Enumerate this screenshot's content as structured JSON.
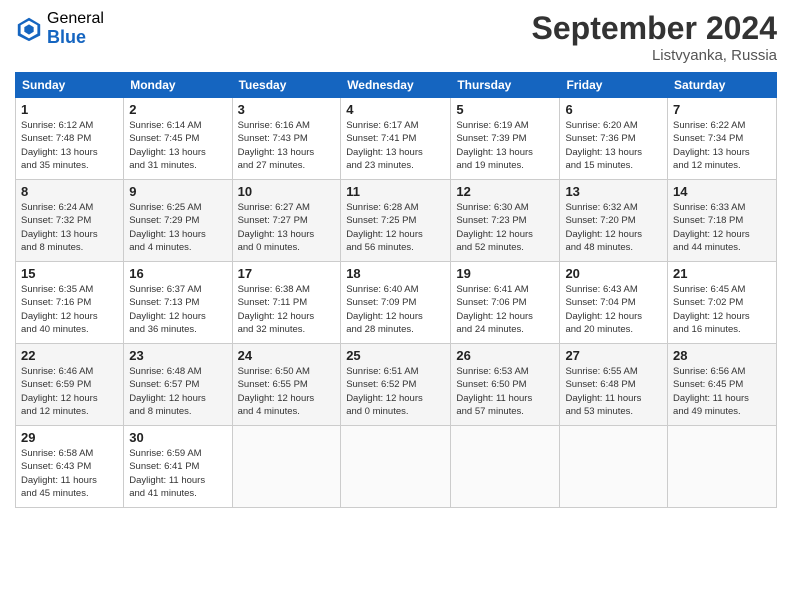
{
  "header": {
    "logo_general": "General",
    "logo_blue": "Blue",
    "month_title": "September 2024",
    "subtitle": "Listvyanka, Russia"
  },
  "weekdays": [
    "Sunday",
    "Monday",
    "Tuesday",
    "Wednesday",
    "Thursday",
    "Friday",
    "Saturday"
  ],
  "weeks": [
    [
      {
        "day": "1",
        "info": "Sunrise: 6:12 AM\nSunset: 7:48 PM\nDaylight: 13 hours\nand 35 minutes."
      },
      {
        "day": "2",
        "info": "Sunrise: 6:14 AM\nSunset: 7:45 PM\nDaylight: 13 hours\nand 31 minutes."
      },
      {
        "day": "3",
        "info": "Sunrise: 6:16 AM\nSunset: 7:43 PM\nDaylight: 13 hours\nand 27 minutes."
      },
      {
        "day": "4",
        "info": "Sunrise: 6:17 AM\nSunset: 7:41 PM\nDaylight: 13 hours\nand 23 minutes."
      },
      {
        "day": "5",
        "info": "Sunrise: 6:19 AM\nSunset: 7:39 PM\nDaylight: 13 hours\nand 19 minutes."
      },
      {
        "day": "6",
        "info": "Sunrise: 6:20 AM\nSunset: 7:36 PM\nDaylight: 13 hours\nand 15 minutes."
      },
      {
        "day": "7",
        "info": "Sunrise: 6:22 AM\nSunset: 7:34 PM\nDaylight: 13 hours\nand 12 minutes."
      }
    ],
    [
      {
        "day": "8",
        "info": "Sunrise: 6:24 AM\nSunset: 7:32 PM\nDaylight: 13 hours\nand 8 minutes."
      },
      {
        "day": "9",
        "info": "Sunrise: 6:25 AM\nSunset: 7:29 PM\nDaylight: 13 hours\nand 4 minutes."
      },
      {
        "day": "10",
        "info": "Sunrise: 6:27 AM\nSunset: 7:27 PM\nDaylight: 13 hours\nand 0 minutes."
      },
      {
        "day": "11",
        "info": "Sunrise: 6:28 AM\nSunset: 7:25 PM\nDaylight: 12 hours\nand 56 minutes."
      },
      {
        "day": "12",
        "info": "Sunrise: 6:30 AM\nSunset: 7:23 PM\nDaylight: 12 hours\nand 52 minutes."
      },
      {
        "day": "13",
        "info": "Sunrise: 6:32 AM\nSunset: 7:20 PM\nDaylight: 12 hours\nand 48 minutes."
      },
      {
        "day": "14",
        "info": "Sunrise: 6:33 AM\nSunset: 7:18 PM\nDaylight: 12 hours\nand 44 minutes."
      }
    ],
    [
      {
        "day": "15",
        "info": "Sunrise: 6:35 AM\nSunset: 7:16 PM\nDaylight: 12 hours\nand 40 minutes."
      },
      {
        "day": "16",
        "info": "Sunrise: 6:37 AM\nSunset: 7:13 PM\nDaylight: 12 hours\nand 36 minutes."
      },
      {
        "day": "17",
        "info": "Sunrise: 6:38 AM\nSunset: 7:11 PM\nDaylight: 12 hours\nand 32 minutes."
      },
      {
        "day": "18",
        "info": "Sunrise: 6:40 AM\nSunset: 7:09 PM\nDaylight: 12 hours\nand 28 minutes."
      },
      {
        "day": "19",
        "info": "Sunrise: 6:41 AM\nSunset: 7:06 PM\nDaylight: 12 hours\nand 24 minutes."
      },
      {
        "day": "20",
        "info": "Sunrise: 6:43 AM\nSunset: 7:04 PM\nDaylight: 12 hours\nand 20 minutes."
      },
      {
        "day": "21",
        "info": "Sunrise: 6:45 AM\nSunset: 7:02 PM\nDaylight: 12 hours\nand 16 minutes."
      }
    ],
    [
      {
        "day": "22",
        "info": "Sunrise: 6:46 AM\nSunset: 6:59 PM\nDaylight: 12 hours\nand 12 minutes."
      },
      {
        "day": "23",
        "info": "Sunrise: 6:48 AM\nSunset: 6:57 PM\nDaylight: 12 hours\nand 8 minutes."
      },
      {
        "day": "24",
        "info": "Sunrise: 6:50 AM\nSunset: 6:55 PM\nDaylight: 12 hours\nand 4 minutes."
      },
      {
        "day": "25",
        "info": "Sunrise: 6:51 AM\nSunset: 6:52 PM\nDaylight: 12 hours\nand 0 minutes."
      },
      {
        "day": "26",
        "info": "Sunrise: 6:53 AM\nSunset: 6:50 PM\nDaylight: 11 hours\nand 57 minutes."
      },
      {
        "day": "27",
        "info": "Sunrise: 6:55 AM\nSunset: 6:48 PM\nDaylight: 11 hours\nand 53 minutes."
      },
      {
        "day": "28",
        "info": "Sunrise: 6:56 AM\nSunset: 6:45 PM\nDaylight: 11 hours\nand 49 minutes."
      }
    ],
    [
      {
        "day": "29",
        "info": "Sunrise: 6:58 AM\nSunset: 6:43 PM\nDaylight: 11 hours\nand 45 minutes."
      },
      {
        "day": "30",
        "info": "Sunrise: 6:59 AM\nSunset: 6:41 PM\nDaylight: 11 hours\nand 41 minutes."
      },
      {
        "day": "",
        "info": ""
      },
      {
        "day": "",
        "info": ""
      },
      {
        "day": "",
        "info": ""
      },
      {
        "day": "",
        "info": ""
      },
      {
        "day": "",
        "info": ""
      }
    ]
  ]
}
